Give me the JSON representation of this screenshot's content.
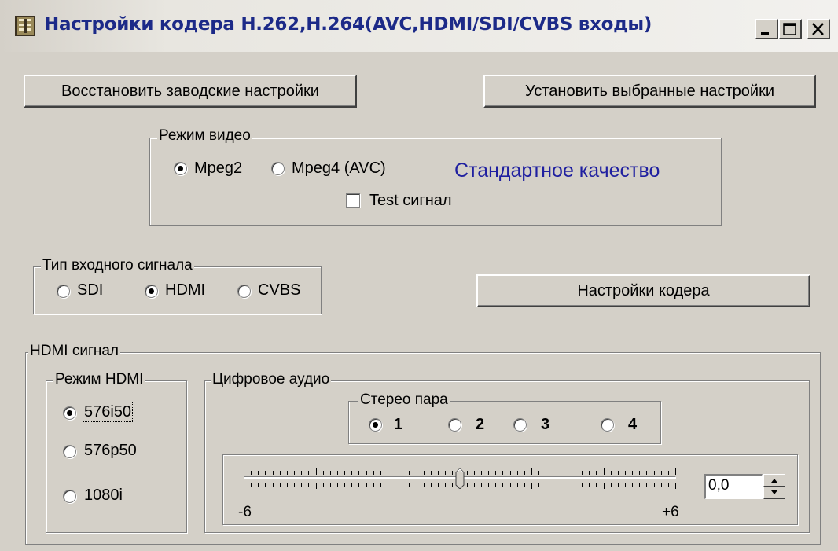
{
  "window": {
    "title": "Настройки кодера H.262,H.264(AVC,HDMI/SDI/CVBS входы)"
  },
  "toolbar": {
    "restore_label": "Восстановить заводские настройки",
    "apply_label": "Установить выбранные настройки",
    "encoder_settings_label": "Настройки кодера"
  },
  "video_mode": {
    "legend": "Режим видео",
    "options": [
      "Mpeg2",
      "Mpeg4 (AVC)"
    ],
    "selected": "Mpeg2",
    "quality_text": "Стандартное качество",
    "test_signal_label": "Test сигнал",
    "test_signal_checked": false
  },
  "input_type": {
    "legend": "Тип входного сигнала",
    "options": [
      "SDI",
      "HDMI",
      "CVBS"
    ],
    "selected": "HDMI"
  },
  "hdmi": {
    "legend": "HDMI сигнал",
    "mode_legend": "Режим HDMI",
    "modes": [
      "576i50",
      "576p50",
      "1080i"
    ],
    "selected_mode": "576i50",
    "audio_legend": "Цифровое аудио",
    "stereo_legend": "Стерео пара",
    "pairs": [
      "1",
      "2",
      "3",
      "4"
    ],
    "selected_pair": "1",
    "slider_min_label": "-6",
    "slider_max_label": "+6",
    "gain_value": "0,0"
  },
  "colors": {
    "title_text": "#1c2a88",
    "quality_text": "#1f1fa0",
    "face": "#d4d0c8"
  },
  "icons": {
    "app": "app-icon",
    "minimize": "minimize-icon",
    "maximize": "maximize-icon",
    "close": "close-icon"
  }
}
